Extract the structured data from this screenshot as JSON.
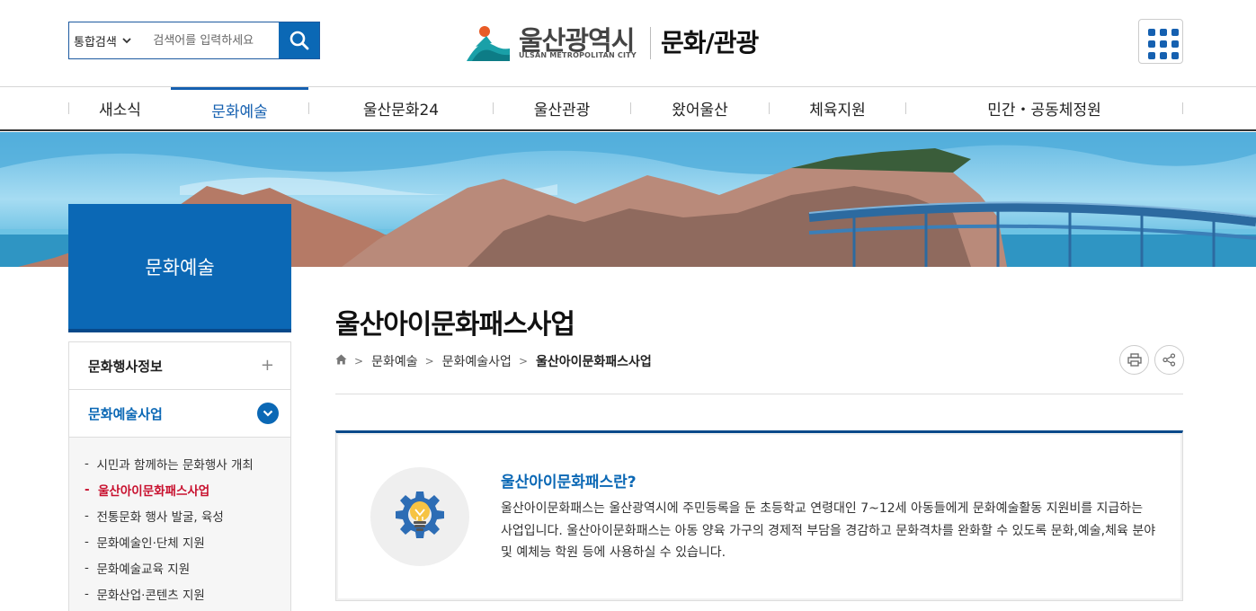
{
  "header": {
    "search_scope": "통합검색",
    "search_placeholder": "검색어를 입력하세요",
    "logo_ko": "울산광역시",
    "logo_en": "ULSAN METROPOLITAN CITY",
    "site_name": "문화/관광"
  },
  "gnb": {
    "items": [
      "새소식",
      "문화예술",
      "울산문화24",
      "울산관광",
      "왔어울산",
      "체육지원",
      "민간・공동체정원"
    ],
    "active_index": 1
  },
  "lnb": {
    "title": "문화예술",
    "menu_1": "문화행사정보",
    "menu_2": "문화예술사업",
    "subitems": [
      "시민과 함께하는 문화행사 개최",
      "울산아이문화패스사업",
      "전통문화 행사 발굴, 육성",
      "문화예술인·단체 지원",
      "문화예술교육 지원",
      "문화산업·콘텐츠 지원"
    ],
    "current_sub_index": 1
  },
  "content": {
    "title": "울산아이문화패스사업",
    "breadcrumb": [
      "문화예술",
      "문화예술사업",
      "울산아이문화패스사업"
    ],
    "info_heading": "울산아이문화패스란?",
    "info_text": "울산아이문화패스는 울산광역시에 주민등록을 둔 초등학교 연령대인 7~12세 아동들에게 문화예술활동 지원비를 지급하는 사업입니다. 울산아이문화패스는 아동 양육 가구의 경제적 부담을 경감하고 문화격차를 완화할 수 있도록 문화,예술,체육 분야 및 예체능 학원 등에 사용하실 수 있습니다."
  },
  "colors": {
    "primary": "#0b68b5",
    "primary_dark": "#07498a",
    "highlight": "#c8102e"
  },
  "icons": [
    "search-icon",
    "chevron-down-icon",
    "grid-menu-icon",
    "home-icon",
    "print-icon",
    "share-icon",
    "plus-icon",
    "lightbulb-gear-icon"
  ]
}
